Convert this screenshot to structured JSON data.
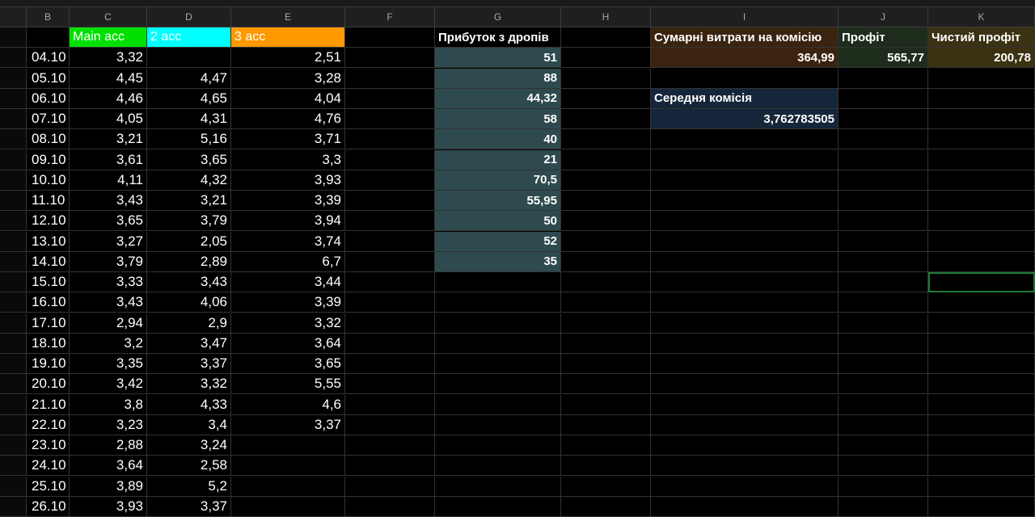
{
  "columns": [
    "B",
    "C",
    "D",
    "E",
    "F",
    "G",
    "H",
    "I",
    "J",
    "K"
  ],
  "acc_headers": {
    "main": "Main acc",
    "acc2": "2 acc",
    "acc3": "3 acc"
  },
  "dates": [
    "04.10",
    "05.10",
    "06.10",
    "07.10",
    "08.10",
    "09.10",
    "10.10",
    "11.10",
    "12.10",
    "13.10",
    "14.10",
    "15.10",
    "16.10",
    "17.10",
    "18.10",
    "19.10",
    "20.10",
    "21.10",
    "22.10",
    "23.10",
    "24.10",
    "25.10",
    "26.10"
  ],
  "col_c": [
    "3,32",
    "4,45",
    "4,46",
    "4,05",
    "3,21",
    "3,61",
    "4,11",
    "3,43",
    "3,65",
    "3,27",
    "3,79",
    "3,33",
    "3,43",
    "2,94",
    "3,2",
    "3,35",
    "3,42",
    "3,8",
    "3,23",
    "2,88",
    "3,64",
    "3,89",
    "3,93"
  ],
  "col_d": [
    "",
    "4,47",
    "4,65",
    "4,31",
    "5,16",
    "3,65",
    "4,32",
    "3,21",
    "3,79",
    "2,05",
    "2,89",
    "3,43",
    "4,06",
    "2,9",
    "3,47",
    "3,37",
    "3,32",
    "4,33",
    "3,4",
    "3,24",
    "2,58",
    "5,2",
    "3,37"
  ],
  "col_e": [
    "2,51",
    "3,28",
    "4,04",
    "4,76",
    "3,71",
    "3,3",
    "3,93",
    "3,39",
    "3,94",
    "3,74",
    "6,7",
    "3,44",
    "3,39",
    "3,32",
    "3,64",
    "3,65",
    "5,55",
    "4,6",
    "3,37",
    "",
    "",
    "",
    ""
  ],
  "profit_drops": {
    "header": "Прибуток з дропів",
    "values": [
      "51",
      "88",
      "44,32",
      "58",
      "40",
      "21",
      "70,5",
      "55,95",
      "50",
      "52",
      "35"
    ]
  },
  "summary": {
    "commission_total_label": "Сумарні витрати на комісію",
    "commission_total_value": "364,99",
    "profit_label": "Профіт",
    "profit_value": "565,77",
    "net_profit_label": "Чистий профіт",
    "net_profit_value": "200,78",
    "avg_commission_label": "Середня комісія",
    "avg_commission_value": "3,762783505"
  },
  "colors": {
    "main_acc": "#00e000",
    "acc2": "#00ffff",
    "acc3": "#ff9900",
    "profit_drops_fill": "#2e4a4e",
    "commission_fill": "#3a2410",
    "profit_fill": "#1e2c1c",
    "net_profit_fill": "#3a3212",
    "avg_commission_fill": "#16263a"
  }
}
